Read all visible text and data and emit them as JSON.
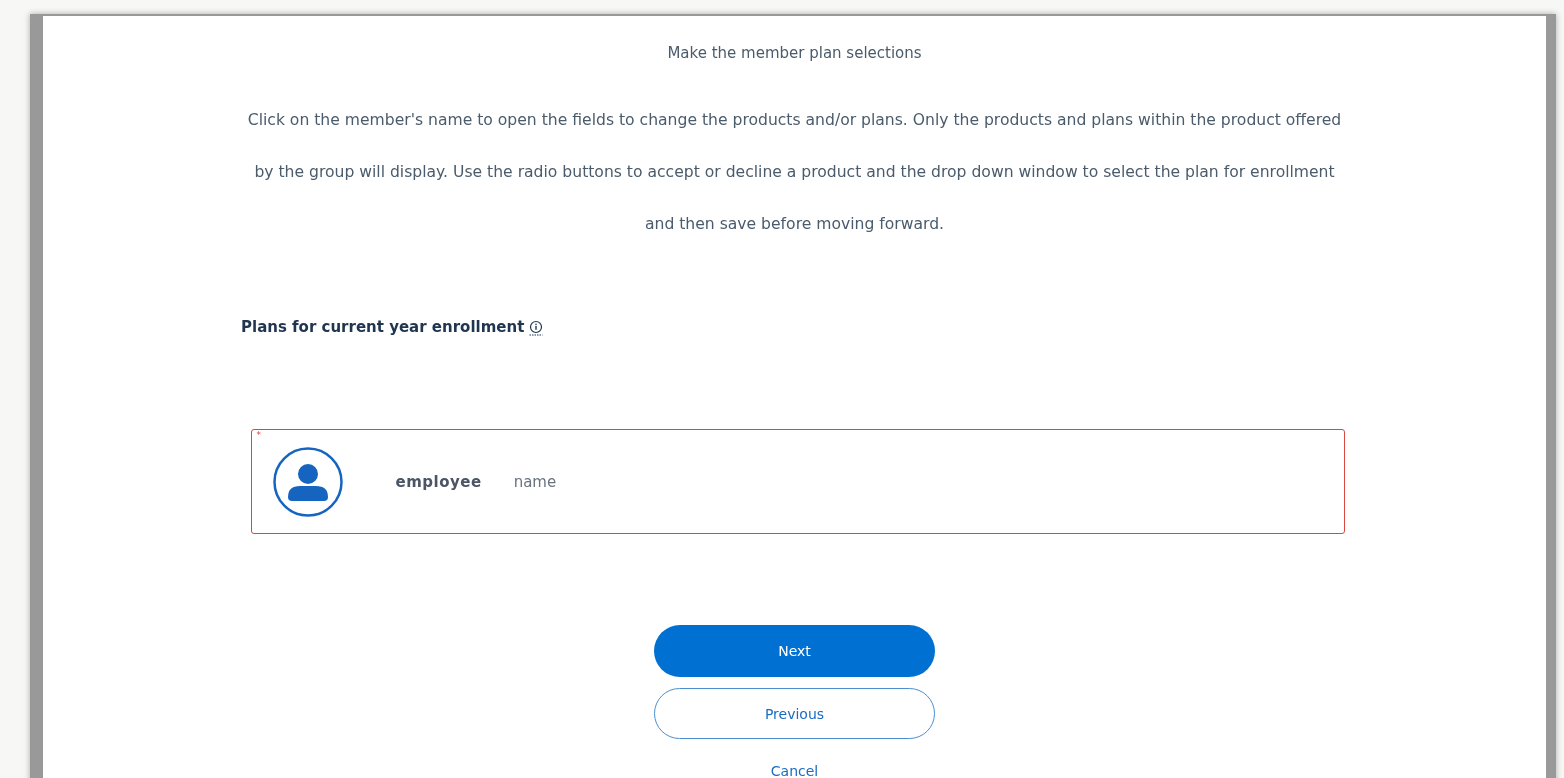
{
  "heading": "Make the member plan selections",
  "instructions": "Click on the member's name to open the fields to change the products and/or plans. Only the products and plans within the product offered by the group will display. Use the radio buttons to accept or decline a product and the drop down window to select the plan for enrollment and then save before moving forward.",
  "section": {
    "title": "Plans for current year enrollment"
  },
  "members": [
    {
      "required_mark": "*",
      "error": true,
      "role": "employee",
      "name": "name"
    }
  ],
  "buttons": [
    {
      "kind": "primary",
      "label": "Next"
    },
    {
      "kind": "secondary",
      "label": "Previous"
    },
    {
      "kind": "link",
      "label": "Cancel"
    }
  ]
}
